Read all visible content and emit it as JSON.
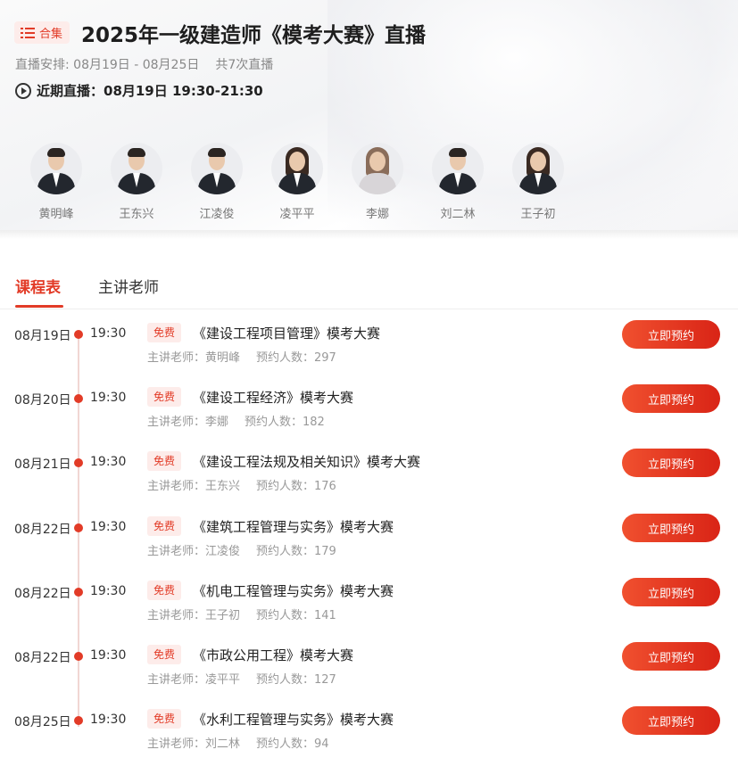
{
  "header": {
    "tag_label": "合集",
    "title": "2025年一级建造师《模考大赛》直播",
    "schedule_label": "直播安排: 08月19日 - 08月25日",
    "schedule_count": "共7次直播",
    "recent_label": "近期直播：08月19日 19:30-21:30"
  },
  "teachers": [
    {
      "name": "黄明峰"
    },
    {
      "name": "王东兴"
    },
    {
      "name": "江凌俊"
    },
    {
      "name": "凌平平"
    },
    {
      "name": "李娜"
    },
    {
      "name": "刘二林"
    },
    {
      "name": "王子初"
    }
  ],
  "tabs": [
    {
      "label": "课程表"
    },
    {
      "label": "主讲老师"
    }
  ],
  "courses": [
    {
      "date": "08月19日",
      "time": "19:30",
      "free": "免费",
      "title": "《建设工程项目管理》模考大赛",
      "teacher": "主讲老师：黄明峰",
      "count": "预约人数：297",
      "button": "立即预约"
    },
    {
      "date": "08月20日",
      "time": "19:30",
      "free": "免费",
      "title": "《建设工程经济》模考大赛",
      "teacher": "主讲老师：李娜",
      "count": "预约人数：182",
      "button": "立即预约"
    },
    {
      "date": "08月21日",
      "time": "19:30",
      "free": "免费",
      "title": "《建设工程法规及相关知识》模考大赛",
      "teacher": "主讲老师：王东兴",
      "count": "预约人数：176",
      "button": "立即预约"
    },
    {
      "date": "08月22日",
      "time": "19:30",
      "free": "免费",
      "title": "《建筑工程管理与实务》模考大赛",
      "teacher": "主讲老师：江凌俊",
      "count": "预约人数：179",
      "button": "立即预约"
    },
    {
      "date": "08月22日",
      "time": "19:30",
      "free": "免费",
      "title": "《机电工程管理与实务》模考大赛",
      "teacher": "主讲老师：王子初",
      "count": "预约人数：141",
      "button": "立即预约"
    },
    {
      "date": "08月22日",
      "time": "19:30",
      "free": "免费",
      "title": "《市政公用工程》模考大赛",
      "teacher": "主讲老师：凌平平",
      "count": "预约人数：127",
      "button": "立即预约"
    },
    {
      "date": "08月25日",
      "time": "19:30",
      "free": "免费",
      "title": "《水利工程管理与实务》模考大赛",
      "teacher": "主讲老师：刘二林",
      "count": "预约人数：94",
      "button": "立即预约"
    }
  ],
  "colors": {
    "accent": "#e23b27",
    "free_bg": "#fdecea"
  }
}
